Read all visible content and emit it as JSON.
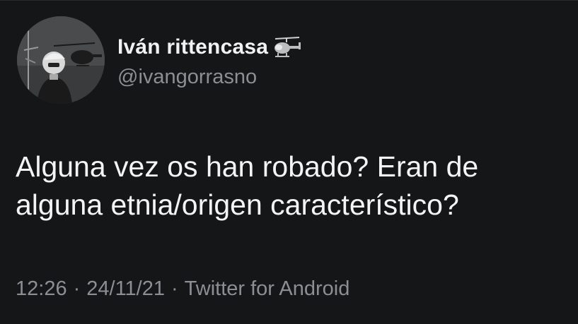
{
  "tweet": {
    "author": {
      "display_name": "Iván rittencasa",
      "name_emoji_icon": "helicopter-icon",
      "handle": "@ivangorrasno",
      "avatar_icon": "avatar-photo"
    },
    "text_lines": [
      "Alguna vez os han robado? Eran de",
      "alguna etnia/origen característico?"
    ],
    "meta": {
      "time": "12:26",
      "date": "24/11/21",
      "separator": "·",
      "source": "Twitter for Android"
    },
    "colors": {
      "background": "#151618",
      "primary_text": "#f4f4f4",
      "secondary_text": "#8b8f93"
    }
  }
}
